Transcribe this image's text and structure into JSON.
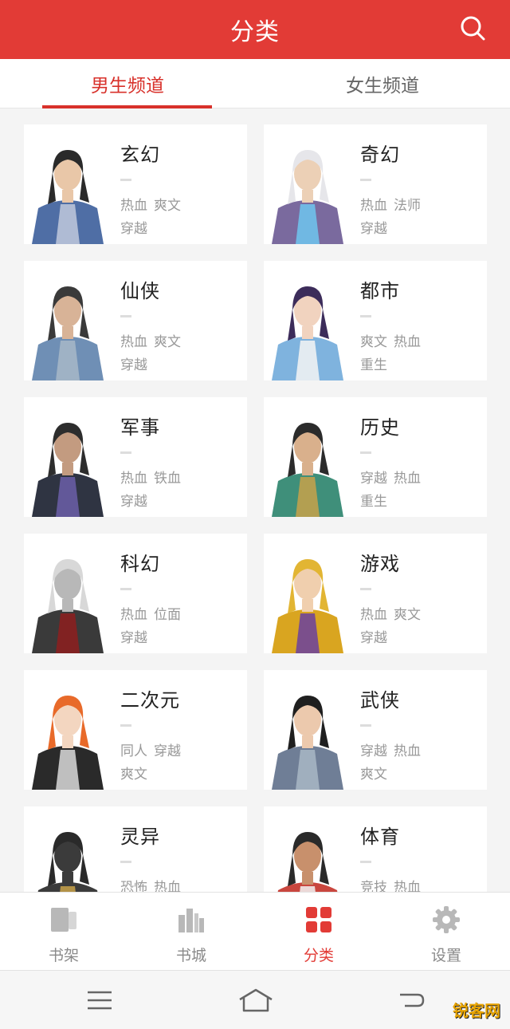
{
  "header": {
    "title": "分类"
  },
  "tabs": [
    {
      "label": "男生频道",
      "active": true
    },
    {
      "label": "女生频道",
      "active": false
    }
  ],
  "categories": [
    {
      "name": "玄幻",
      "tags": [
        "热血",
        "爽文",
        "穿越"
      ]
    },
    {
      "name": "奇幻",
      "tags": [
        "热血",
        "法师",
        "穿越"
      ]
    },
    {
      "name": "仙侠",
      "tags": [
        "热血",
        "爽文",
        "穿越"
      ]
    },
    {
      "name": "都市",
      "tags": [
        "爽文",
        "热血",
        "重生"
      ]
    },
    {
      "name": "军事",
      "tags": [
        "热血",
        "铁血",
        "穿越"
      ]
    },
    {
      "name": "历史",
      "tags": [
        "穿越",
        "热血",
        "重生"
      ]
    },
    {
      "name": "科幻",
      "tags": [
        "热血",
        "位面",
        "穿越"
      ]
    },
    {
      "name": "游戏",
      "tags": [
        "热血",
        "爽文",
        "穿越"
      ]
    },
    {
      "name": "二次元",
      "tags": [
        "同人",
        "穿越",
        "爽文"
      ]
    },
    {
      "name": "武侠",
      "tags": [
        "穿越",
        "热血",
        "爽文"
      ]
    },
    {
      "name": "灵异",
      "tags": [
        "恐怖",
        "热血"
      ]
    },
    {
      "name": "体育",
      "tags": [
        "竞技",
        "热血"
      ]
    }
  ],
  "bottom_nav": [
    {
      "label": "书架",
      "icon": "bookshelf-icon",
      "active": false
    },
    {
      "label": "书城",
      "icon": "bookstore-icon",
      "active": false
    },
    {
      "label": "分类",
      "icon": "category-icon",
      "active": true
    },
    {
      "label": "设置",
      "icon": "settings-icon",
      "active": false
    }
  ],
  "watermark": "锐客网",
  "colors": {
    "accent": "#e23b36",
    "tag_text": "#999999",
    "background": "#f4f4f4"
  }
}
